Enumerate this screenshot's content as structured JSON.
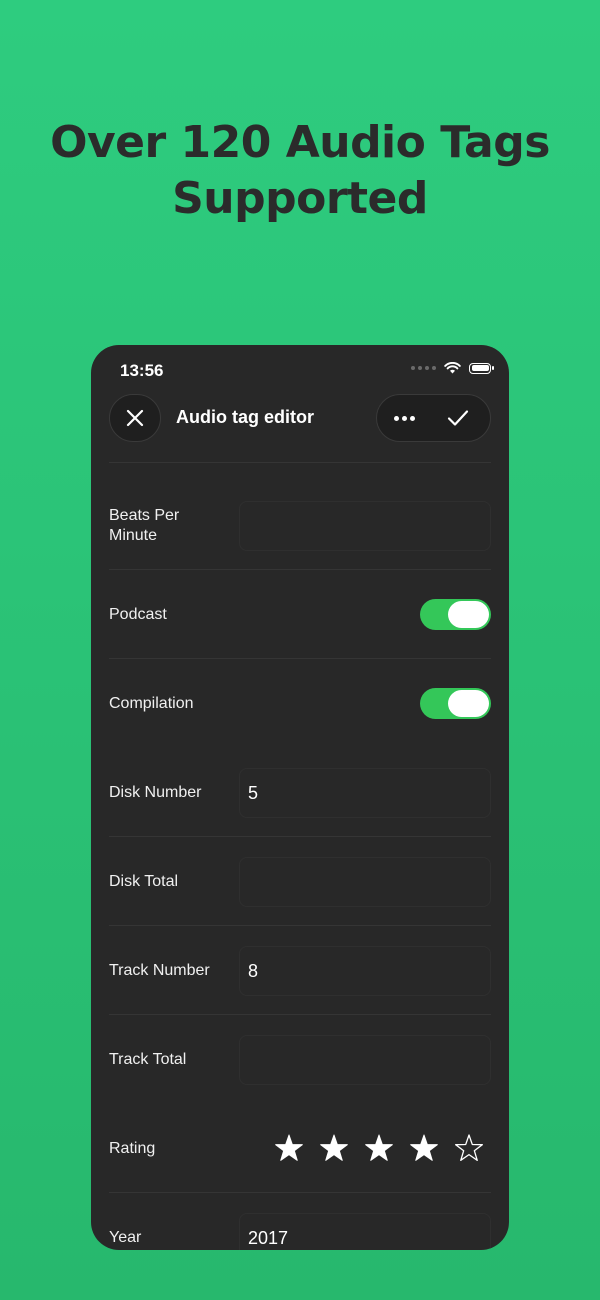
{
  "headline": {
    "line1": "Over 120 Audio Tags",
    "line2": "Supported"
  },
  "status_bar": {
    "time": "13:56"
  },
  "nav": {
    "title": "Audio tag editor",
    "close_icon": "close-icon",
    "more_icon": "more-icon",
    "confirm_icon": "checkmark-icon"
  },
  "form": {
    "rows": [
      {
        "label": "Beats Per Minute",
        "type": "text",
        "value": ""
      },
      {
        "label": "Podcast",
        "type": "toggle",
        "on": true
      },
      {
        "label": "Compilation",
        "type": "toggle",
        "on": true
      },
      {
        "label": "Disk Number",
        "type": "text",
        "value": "5"
      },
      {
        "label": "Disk Total",
        "type": "text",
        "value": ""
      },
      {
        "label": "Track Number",
        "type": "text",
        "value": "8"
      },
      {
        "label": "Track Total",
        "type": "text",
        "value": ""
      },
      {
        "label": "Rating",
        "type": "rating",
        "value": 4,
        "max": 5
      },
      {
        "label": "Year",
        "type": "text",
        "value": "2017"
      }
    ]
  },
  "colors": {
    "background": "#2ecc7f",
    "panel": "#282828",
    "toggle_on": "#34c759",
    "headline": "#2b2b2b"
  }
}
